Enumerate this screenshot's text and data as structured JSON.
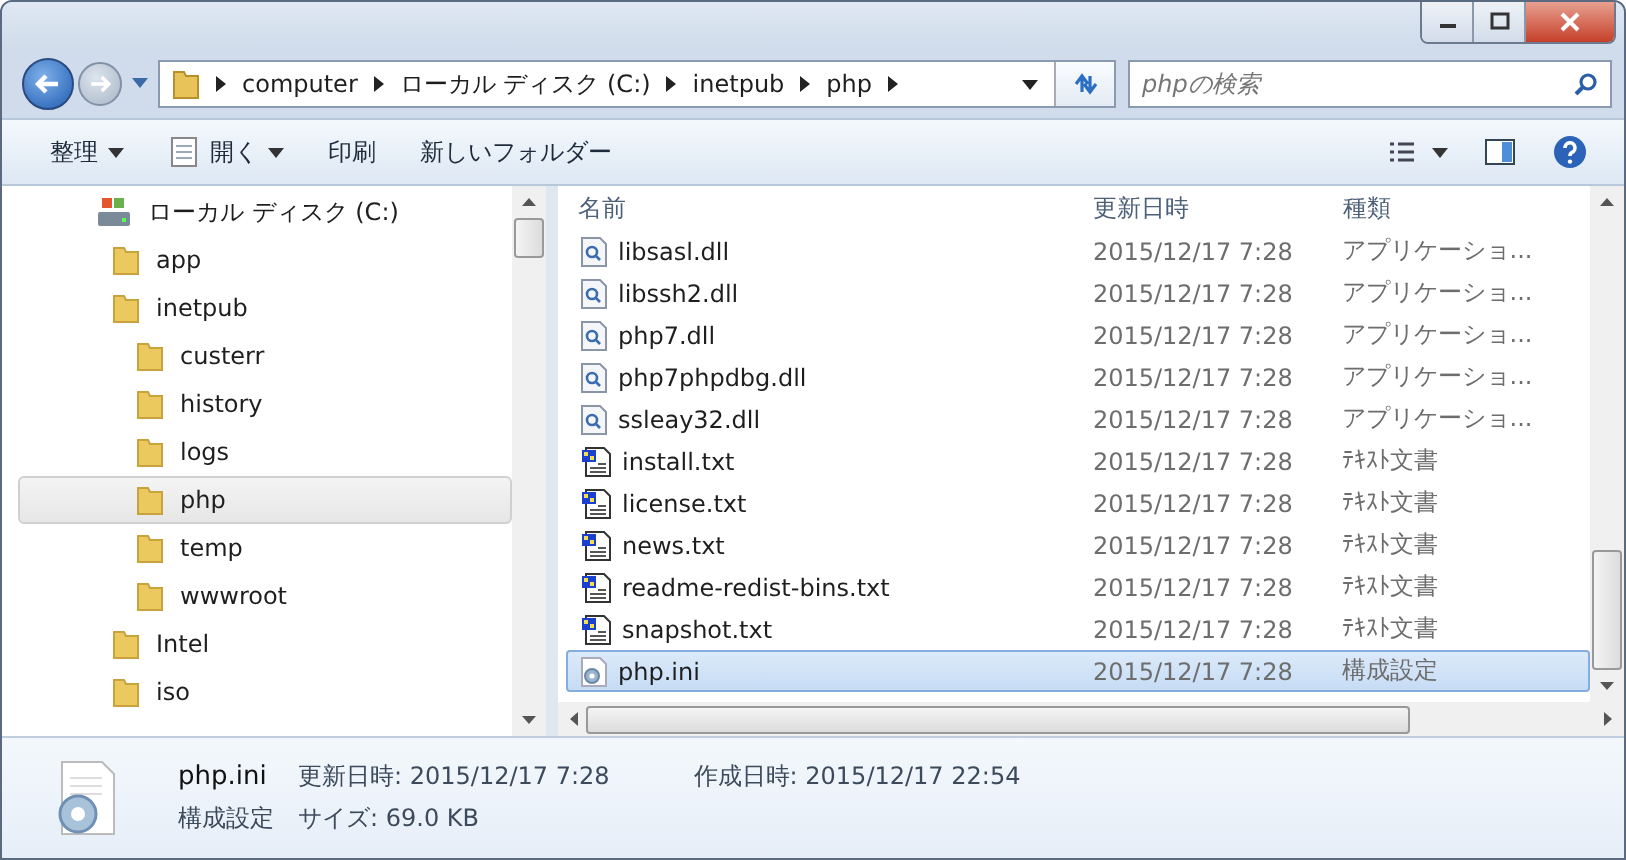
{
  "address_bar": {
    "crumbs": [
      "computer",
      "ローカル ディスク (C:)",
      "inetpub",
      "php"
    ]
  },
  "search": {
    "placeholder": "phpの検索"
  },
  "toolbar": {
    "items": [
      {
        "label": "整理",
        "kind": "menu"
      },
      {
        "label": "開く",
        "kind": "open"
      },
      {
        "label": "印刷",
        "kind": "plain"
      },
      {
        "label": "新しいフォルダー",
        "kind": "plain"
      }
    ]
  },
  "navigation_pane": {
    "root": {
      "label": "ローカル ディスク (C:)",
      "selected": false,
      "children": [
        {
          "label": "app",
          "selected": false
        },
        {
          "label": "inetpub",
          "selected": false,
          "children": [
            {
              "label": "custerr",
              "selected": false
            },
            {
              "label": "history",
              "selected": false
            },
            {
              "label": "logs",
              "selected": false
            },
            {
              "label": "php",
              "selected": true
            },
            {
              "label": "temp",
              "selected": false
            },
            {
              "label": "wwwroot",
              "selected": false
            }
          ]
        },
        {
          "label": "Intel",
          "selected": false
        },
        {
          "label": "iso",
          "selected": false
        }
      ]
    }
  },
  "file_list": {
    "columns": [
      "名前",
      "更新日時",
      "種類"
    ],
    "rows": [
      {
        "name": "libsasl.dll",
        "modified": "2015/12/17 7:28",
        "type": "アプリケーショ...",
        "kind": "dll",
        "selected": false
      },
      {
        "name": "libssh2.dll",
        "modified": "2015/12/17 7:28",
        "type": "アプリケーショ...",
        "kind": "dll",
        "selected": false
      },
      {
        "name": "php7.dll",
        "modified": "2015/12/17 7:28",
        "type": "アプリケーショ...",
        "kind": "dll",
        "selected": false
      },
      {
        "name": "php7phpdbg.dll",
        "modified": "2015/12/17 7:28",
        "type": "アプリケーショ...",
        "kind": "dll",
        "selected": false
      },
      {
        "name": "ssleay32.dll",
        "modified": "2015/12/17 7:28",
        "type": "アプリケーショ...",
        "kind": "dll",
        "selected": false
      },
      {
        "name": "install.txt",
        "modified": "2015/12/17 7:28",
        "type": "ﾃｷｽﾄ文書",
        "kind": "txt",
        "selected": false
      },
      {
        "name": "license.txt",
        "modified": "2015/12/17 7:28",
        "type": "ﾃｷｽﾄ文書",
        "kind": "txt",
        "selected": false
      },
      {
        "name": "news.txt",
        "modified": "2015/12/17 7:28",
        "type": "ﾃｷｽﾄ文書",
        "kind": "txt",
        "selected": false
      },
      {
        "name": "readme-redist-bins.txt",
        "modified": "2015/12/17 7:28",
        "type": "ﾃｷｽﾄ文書",
        "kind": "txt",
        "selected": false
      },
      {
        "name": "snapshot.txt",
        "modified": "2015/12/17 7:28",
        "type": "ﾃｷｽﾄ文書",
        "kind": "txt",
        "selected": false
      },
      {
        "name": "php.ini",
        "modified": "2015/12/17 7:28",
        "type": "構成設定",
        "kind": "ini",
        "selected": true
      }
    ]
  },
  "details_pane": {
    "name": "php.ini",
    "modified": "更新日時: 2015/12/17 7:28",
    "created": "作成日時: 2015/12/17 22:54",
    "type": "構成設定",
    "size": "サイズ: 69.0 KB"
  }
}
